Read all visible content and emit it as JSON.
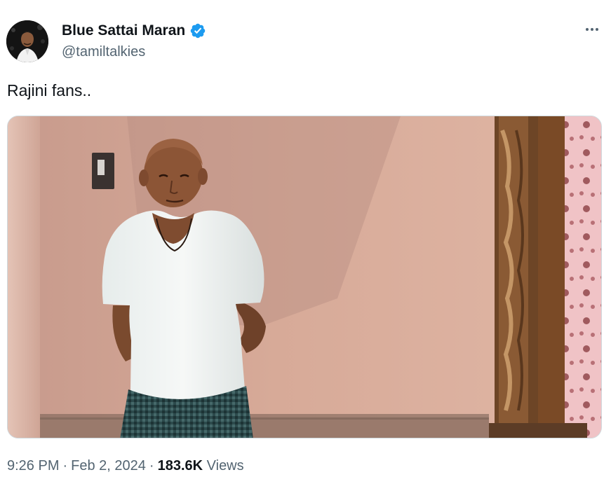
{
  "author": {
    "display_name": "Blue Sattai Maran",
    "handle": "@tamiltalkies",
    "verified": true,
    "verified_color": "#1d9bf0"
  },
  "tweet": {
    "text": "Rajini fans.."
  },
  "meta": {
    "time": "9:26 PM",
    "separator": "·",
    "date": "Feb 2, 2024",
    "views_count": "183.6K",
    "views_label": "Views"
  },
  "icons": {
    "more": "more-dots-icon",
    "verified": "verified-badge-icon"
  }
}
